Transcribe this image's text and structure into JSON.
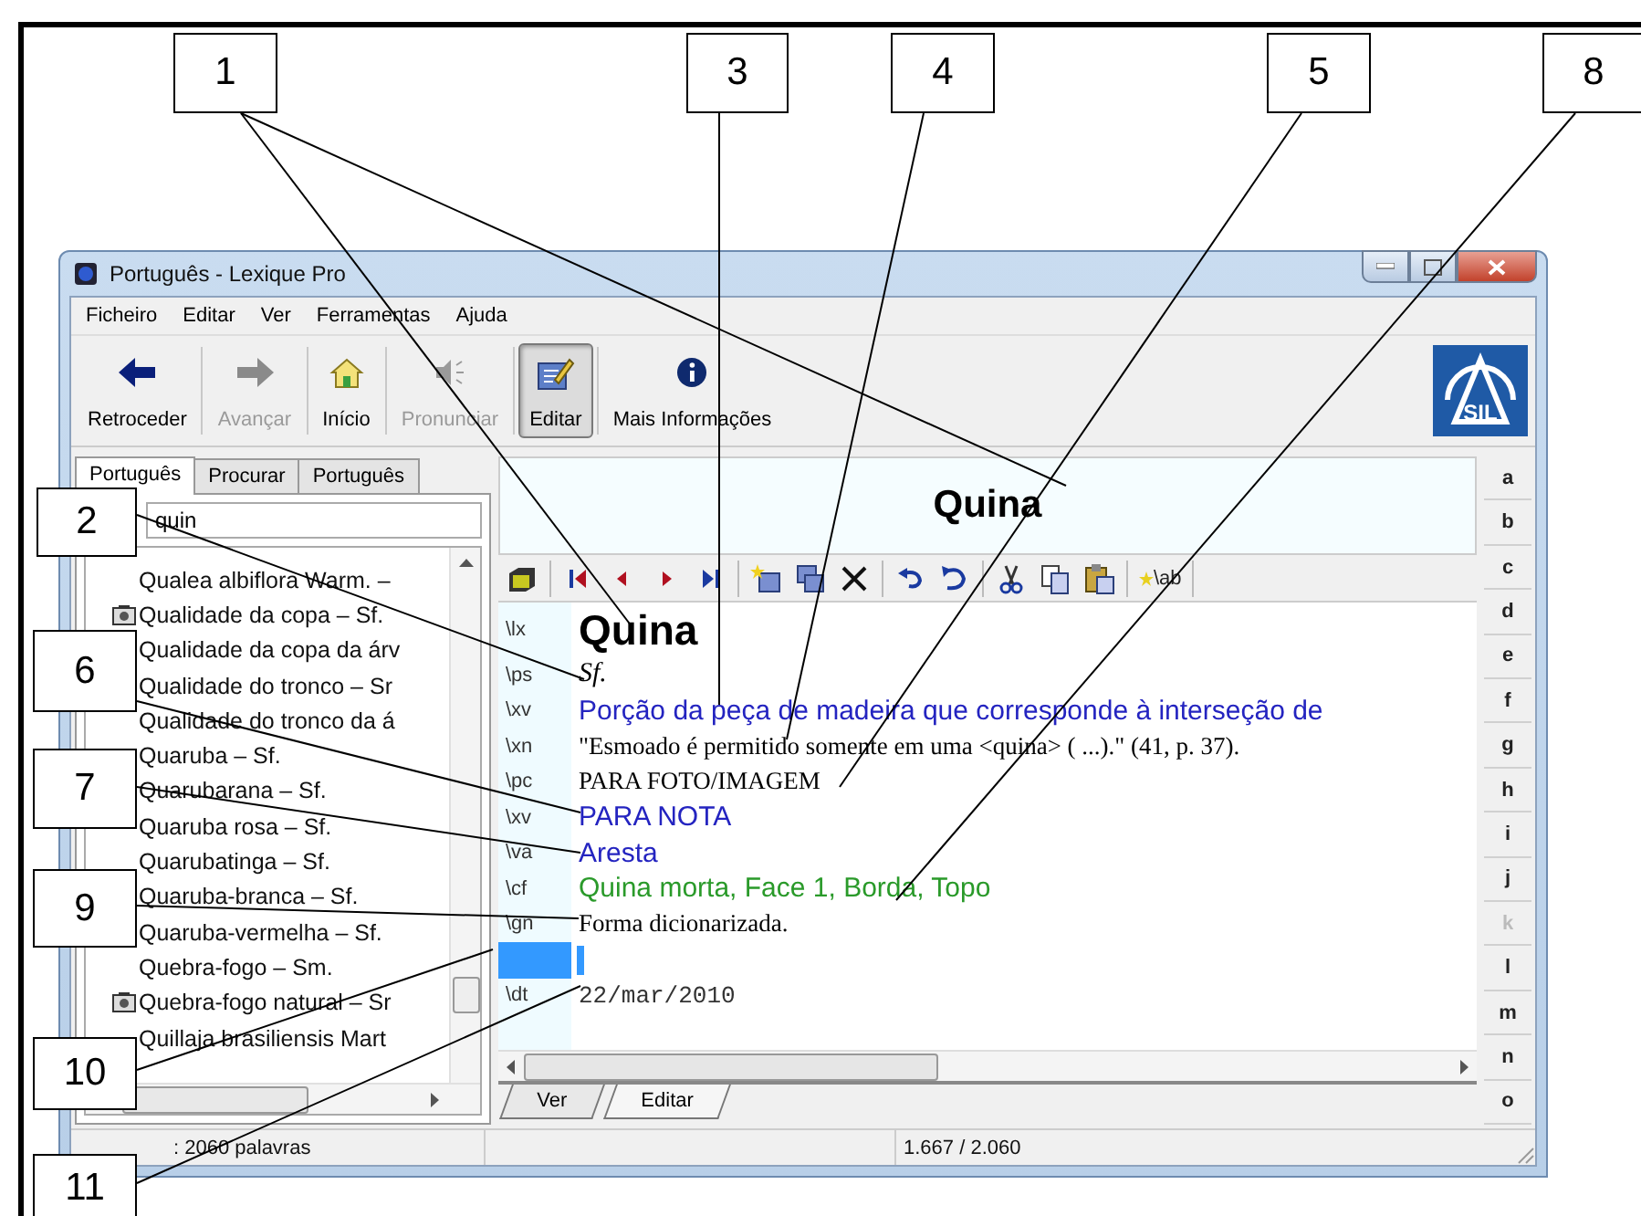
{
  "window": {
    "title": "Português - Lexique Pro"
  },
  "menu": [
    {
      "label": "Ficheiro"
    },
    {
      "label": "Editar"
    },
    {
      "label": "Ver"
    },
    {
      "label": "Ferramentas"
    },
    {
      "label": "Ajuda"
    }
  ],
  "toolbar": [
    {
      "label": "Retroceder",
      "kind": "back",
      "disabled": false,
      "pressed": false
    },
    {
      "label": "Avançar",
      "kind": "forward",
      "disabled": true,
      "pressed": false
    },
    {
      "label": "Início",
      "kind": "home",
      "disabled": false,
      "pressed": false
    },
    {
      "label": "Pronunciar",
      "kind": "speaker",
      "disabled": true,
      "pressed": false
    },
    {
      "label": "Editar",
      "kind": "edit",
      "disabled": false,
      "pressed": true
    },
    {
      "label": "Mais Informações",
      "kind": "info",
      "disabled": false,
      "pressed": false
    }
  ],
  "logo": {
    "text": "SIL"
  },
  "left_tabs": [
    {
      "label": "Português",
      "selected": true
    },
    {
      "label": "Procurar",
      "selected": false
    },
    {
      "label": "Português",
      "selected": false
    }
  ],
  "search": {
    "value": "quin"
  },
  "word_list": [
    {
      "text": "Qualea albiflora Warm. –",
      "has_picture": false
    },
    {
      "text": "Qualidade da copa – Sf.",
      "has_picture": true
    },
    {
      "text": "Qualidade da copa da árv",
      "has_picture": false
    },
    {
      "text": "Qualidade do tronco – Sr",
      "has_picture": false
    },
    {
      "text": "Qualidade do tronco da á",
      "has_picture": false
    },
    {
      "text": "Quaruba – Sf.",
      "has_picture": false
    },
    {
      "text": "Quarubarana – Sf.",
      "has_picture": false
    },
    {
      "text": "Quaruba rosa – Sf.",
      "has_picture": false
    },
    {
      "text": "Quarubatinga – Sf.",
      "has_picture": false
    },
    {
      "text": "Quaruba-branca – Sf.",
      "has_picture": false
    },
    {
      "text": "Quaruba-vermelha – Sf.",
      "has_picture": false
    },
    {
      "text": "Quebra-fogo – Sm.",
      "has_picture": false
    },
    {
      "text": "Quebra-fogo natural – Sr",
      "has_picture": true
    },
    {
      "text": "Quillaja brasiliensis Mart",
      "has_picture": false
    }
  ],
  "entry_header": "Quina",
  "insert_field_label": "\\ab",
  "fields": [
    {
      "marker": "\\lx",
      "text": "Quina",
      "kind": "headword",
      "selected": false
    },
    {
      "marker": "\\ps",
      "text": "Sf.",
      "kind": "italic",
      "selected": false
    },
    {
      "marker": "\\xv",
      "text": "Porção da peça de madeira que corresponde à interseção de",
      "kind": "blue",
      "selected": false
    },
    {
      "marker": "\\xn",
      "text": "\"Esmoado é permitido somente em uma <quina> ( ...).\" (41, p. 37).",
      "kind": "serif",
      "selected": false
    },
    {
      "marker": "\\pc",
      "text": "PARA FOTO/IMAGEM",
      "kind": "serif",
      "selected": false
    },
    {
      "marker": "\\xv",
      "text": "PARA NOTA",
      "kind": "blue",
      "selected": false
    },
    {
      "marker": "\\va",
      "text": "Aresta",
      "kind": "blue",
      "selected": false
    },
    {
      "marker": "\\cf",
      "text": "Quina morta, Face 1, Borda, Topo",
      "kind": "green",
      "selected": false
    },
    {
      "marker": "\\gn",
      "text": "Forma dicionarizada.",
      "kind": "serif",
      "selected": false
    },
    {
      "kind": "blank",
      "selected": true
    },
    {
      "marker": "\\dt",
      "text": "22/mar/2010",
      "kind": "mono",
      "selected": false
    }
  ],
  "view_tabs": [
    {
      "label": "Ver",
      "selected": false
    },
    {
      "label": "Editar",
      "selected": true
    }
  ],
  "alphabet": [
    {
      "letter": "a",
      "disabled": false
    },
    {
      "letter": "b",
      "disabled": false
    },
    {
      "letter": "c",
      "disabled": false
    },
    {
      "letter": "d",
      "disabled": false
    },
    {
      "letter": "e",
      "disabled": false
    },
    {
      "letter": "f",
      "disabled": false
    },
    {
      "letter": "g",
      "disabled": false
    },
    {
      "letter": "h",
      "disabled": false
    },
    {
      "letter": "i",
      "disabled": false
    },
    {
      "letter": "j",
      "disabled": false
    },
    {
      "letter": "k",
      "disabled": true
    },
    {
      "letter": "l",
      "disabled": false
    },
    {
      "letter": "m",
      "disabled": false
    },
    {
      "letter": "n",
      "disabled": false
    },
    {
      "letter": "o",
      "disabled": false
    }
  ],
  "status_bar": {
    "word_count": ": 2060 palavras",
    "position": "1.667 / 2.060"
  },
  "callouts": [
    {
      "label": "1"
    },
    {
      "label": "3"
    },
    {
      "label": "4"
    },
    {
      "label": "5"
    },
    {
      "label": "8"
    },
    {
      "label": "2"
    },
    {
      "label": "6"
    },
    {
      "label": "7"
    },
    {
      "label": "9"
    },
    {
      "label": "10"
    },
    {
      "label": "11"
    }
  ]
}
